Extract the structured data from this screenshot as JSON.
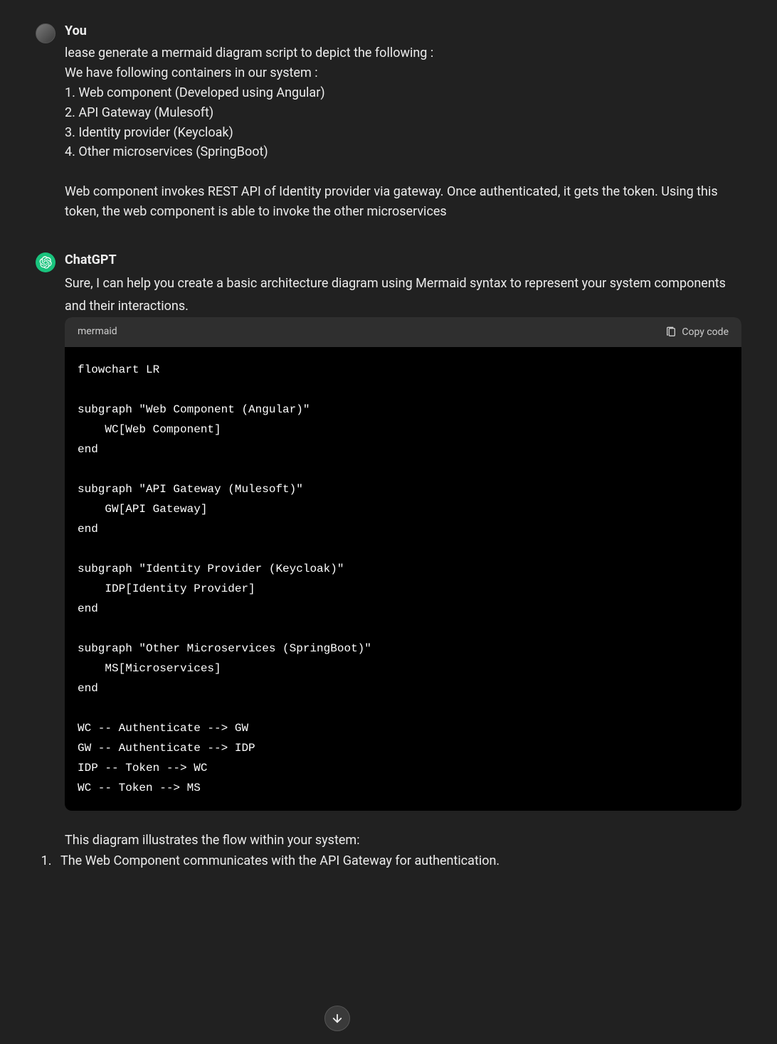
{
  "user": {
    "name": "You",
    "message": "lease generate a mermaid diagram script to depict the following :\nWe have following containers in our system :\n1. Web component (Developed using Angular)\n2. API Gateway (Mulesoft)\n3. Identity provider (Keycloak)\n4. Other microservices (SpringBoot)\n\nWeb component invokes REST API of Identity provider via gateway. Once authenticated, it gets the token. Using this token, the web component is able to invoke the other microservices"
  },
  "assistant": {
    "name": "ChatGPT",
    "intro": "Sure, I can help you create a basic architecture diagram using Mermaid syntax to represent your system components and their interactions.",
    "code_lang": "mermaid",
    "copy_label": "Copy code",
    "code": "flowchart LR\n\nsubgraph \"Web Component (Angular)\"\n    WC[Web Component]\nend\n\nsubgraph \"API Gateway (Mulesoft)\"\n    GW[API Gateway]\nend\n\nsubgraph \"Identity Provider (Keycloak)\"\n    IDP[Identity Provider]\nend\n\nsubgraph \"Other Microservices (SpringBoot)\"\n    MS[Microservices]\nend\n\nWC -- Authenticate --> GW\nGW -- Authenticate --> IDP\nIDP -- Token --> WC\nWC -- Token --> MS",
    "outro": "This diagram illustrates the flow within your system:",
    "list_items": [
      "The Web Component communicates with the API Gateway for authentication."
    ]
  }
}
